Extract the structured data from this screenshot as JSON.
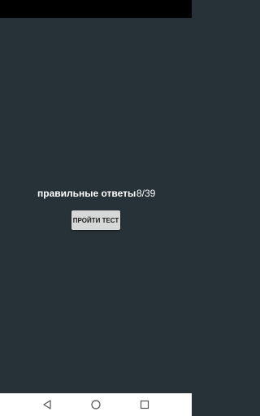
{
  "result": {
    "label": "правильные ответы",
    "score": "8/39"
  },
  "actions": {
    "take_test_label": "ПРОЙТИ ТЕСТ"
  },
  "navigation": {
    "icons": [
      "back-icon",
      "home-icon",
      "recents-icon"
    ]
  },
  "colors": {
    "background": "#263238",
    "status_bar": "#000000",
    "nav_bar": "#ffffff",
    "button": "#d6d7d7",
    "text": "#ffffff"
  }
}
